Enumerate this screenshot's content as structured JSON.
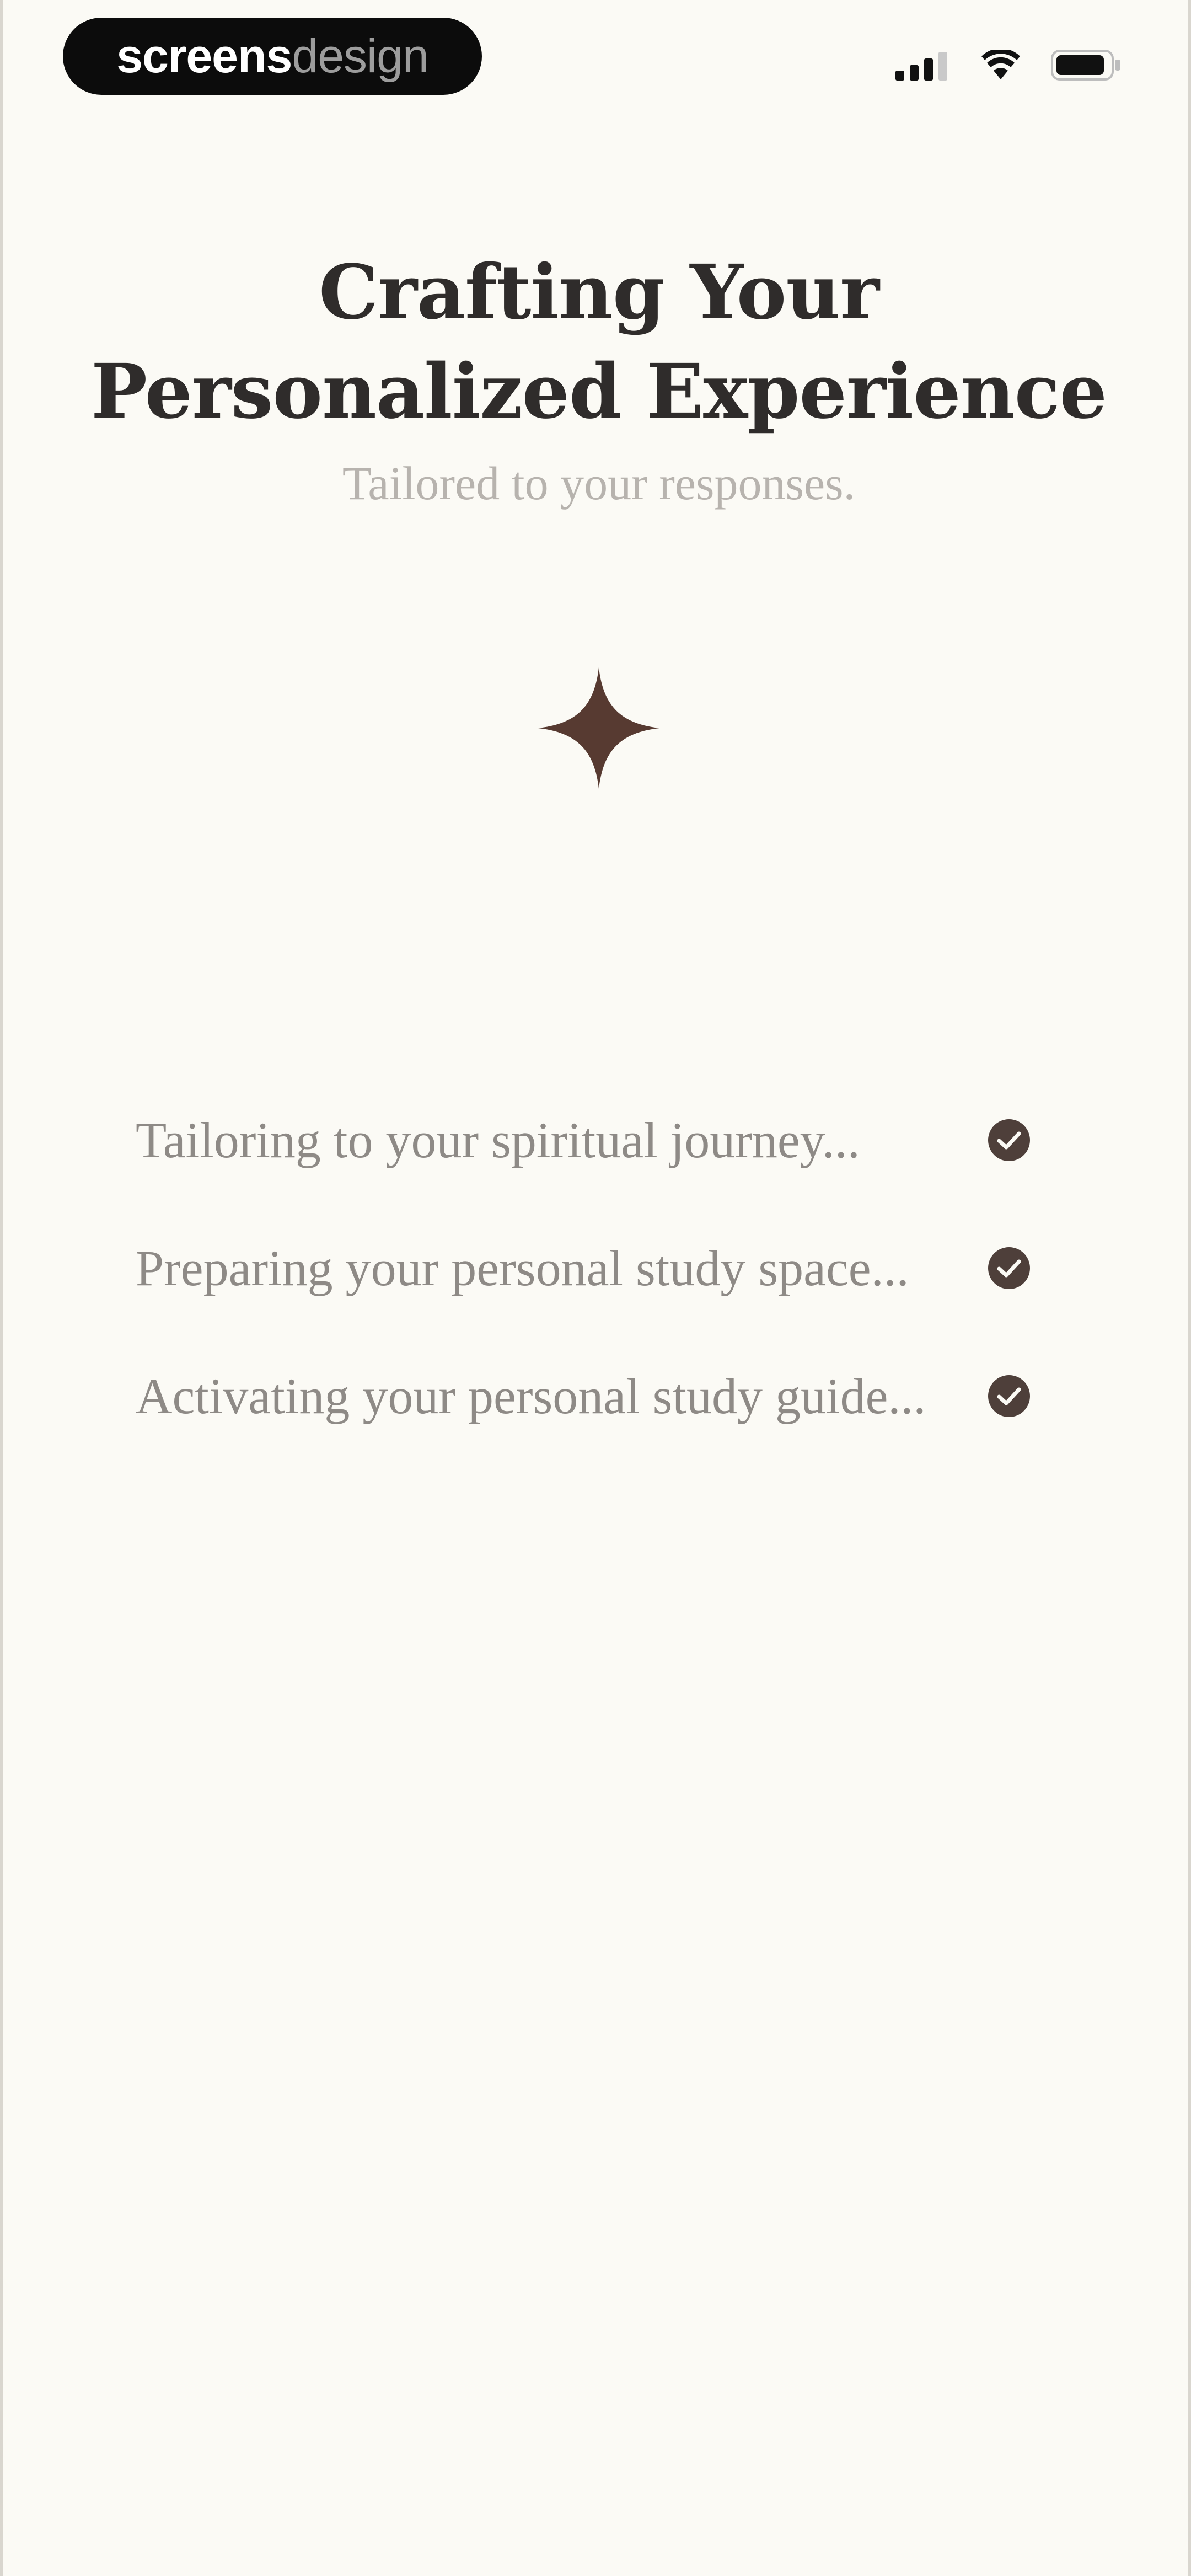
{
  "status_bar": {
    "brand_bold": "screens",
    "brand_light": "design",
    "icons": [
      "signal-icon",
      "wifi-icon",
      "battery-icon"
    ]
  },
  "header": {
    "title_line1": "Crafting Your",
    "title_line2": "Personalized Experience",
    "subtitle": "Tailored to your responses."
  },
  "sparkle": {
    "icon": "sparkle-icon",
    "color": "#573A31"
  },
  "checklist": {
    "items": [
      {
        "label": "Tailoring to your spiritual journey...",
        "status": "complete"
      },
      {
        "label": "Preparing your personal study space...",
        "status": "complete"
      },
      {
        "label": "Activating your personal study guide...",
        "status": "complete"
      }
    ],
    "check_color": "#4E3F3A"
  },
  "colors": {
    "background": "#FBFAF5",
    "title": "#2F2C2B",
    "subtitle": "#B7B3AE",
    "item_text": "#8E8A86",
    "accent": "#573A31"
  }
}
